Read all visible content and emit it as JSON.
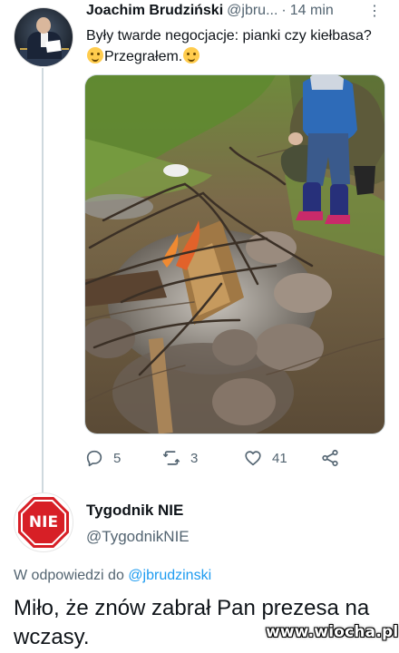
{
  "tweet1": {
    "author_name": "Joachim Brudziński",
    "handle": "@jbru...",
    "separator": "·",
    "time": "14 min",
    "text_part1": "Były twarde negocjacje: pianki czy kiełbasa?",
    "text_part2": "Przegrałem.",
    "emojis": [
      "thinking-face-emoji",
      "winking-face-emoji"
    ],
    "actions": {
      "replies": "5",
      "retweets": "3",
      "likes": "41"
    }
  },
  "tweet2": {
    "author_name": "Tygodnik NIE",
    "handle": "@TygodnikNIE",
    "avatar_text": "NIE",
    "reply_prefix": "W odpowiedzi do",
    "reply_handle": "@jbrudzinski",
    "text": "Miło, że znów zabrał Pan prezesa na wczasy."
  },
  "watermark": "www.wiocha.pl",
  "colors": {
    "accent": "#1d9bf0",
    "secondary_text": "#536471",
    "nie_red": "#d71f26"
  }
}
